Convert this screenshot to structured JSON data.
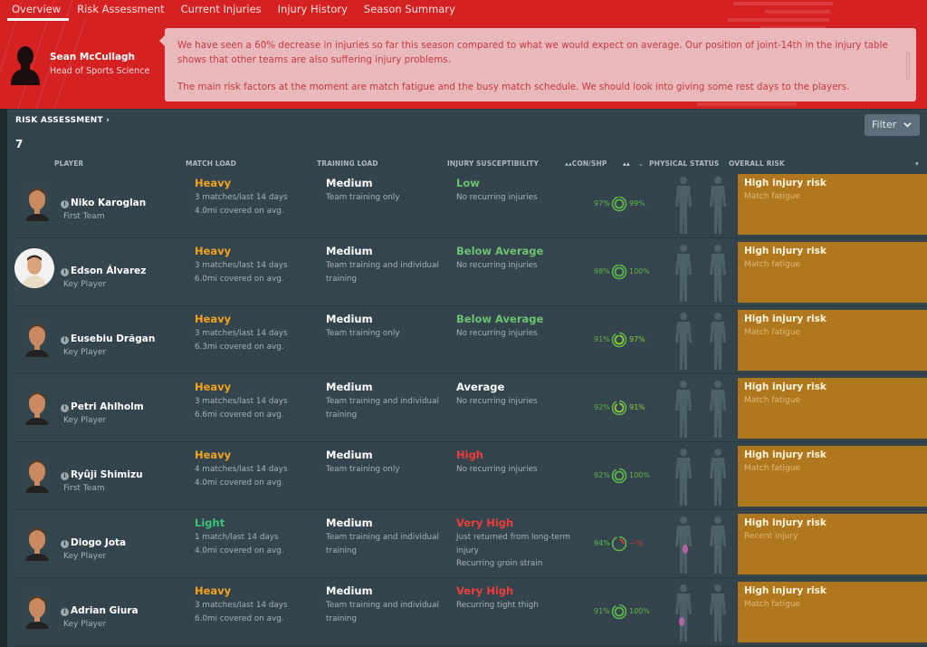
{
  "tabs": [
    {
      "label": "Overview",
      "active": true
    },
    {
      "label": "Risk Assessment",
      "active": false
    },
    {
      "label": "Current Injuries",
      "active": false
    },
    {
      "label": "Injury History",
      "active": false
    },
    {
      "label": "Season Summary",
      "active": false
    }
  ],
  "advisor": {
    "name": "Sean McCullagh",
    "role": "Head of Sports Science",
    "message_1": "We have seen a 60% decrease in injuries so far this season compared to what we would expect on average. Our position of joint-14th in the injury table shows that other teams are also suffering injury problems.",
    "message_2": "The main risk factors at the moment are match fatigue and the busy match schedule. We should look into giving some rest days to the players."
  },
  "section": {
    "title": "RISK ASSESSMENT ›",
    "count": "7",
    "filter_label": "Filter"
  },
  "columns": {
    "player": "PLAYER",
    "match_load": "MATCH LOAD",
    "training_load": "TRAINING LOAD",
    "injury_susceptibility": "INJURY SUSCEPTIBILITY",
    "con_shp": "▴▴CON/SHP",
    "physical_status_sort": "▴▴",
    "physical_status": "PHYSICAL STATUS",
    "overall_risk": "OVERALL RISK"
  },
  "colors": {
    "header_red": "#d42122",
    "panel": "#33434b",
    "heavy": "#f3a31e",
    "light": "#39c47a",
    "susc_green": "#6ec273",
    "susc_red": "#f23c3c",
    "risk_box": "#b0781e",
    "condition_green": "#5fb54b"
  },
  "players": [
    {
      "name": "Niko Karoglan",
      "status": "First Team",
      "avatar": "face",
      "match_load": "Heavy",
      "match_load_class": "orange",
      "match_detail_1": "3 matches/last 14 days",
      "match_detail_2": "4.0mi covered on avg.",
      "training_load": "Medium",
      "training_detail": "Team training only",
      "susceptibility": "Low",
      "susc_class": "green",
      "susc_detail_1": "No recurring injuries",
      "susc_detail_2": "",
      "condition": "97%",
      "sharpness": "99%",
      "condition_value": 97,
      "sharpness_value": 99,
      "sharpness_color": "#5fb54b",
      "injury_marker": "",
      "risk": "High injury risk",
      "risk_reason": "Match fatigue"
    },
    {
      "name": "Edson Álvarez",
      "status": "Key Player",
      "avatar": "round",
      "match_load": "Heavy",
      "match_load_class": "orange",
      "match_detail_1": "3 matches/last 14 days",
      "match_detail_2": "6.0mi covered on avg.",
      "training_load": "Medium",
      "training_detail": "Team training and individual training",
      "susceptibility": "Below Average",
      "susc_class": "green",
      "susc_detail_1": "No recurring injuries",
      "susc_detail_2": "",
      "condition": "98%",
      "sharpness": "100%",
      "condition_value": 98,
      "sharpness_value": 100,
      "sharpness_color": "#5fb54b",
      "injury_marker": "",
      "risk": "High injury risk",
      "risk_reason": "Match fatigue"
    },
    {
      "name": "Eusebiu Drăgan",
      "status": "Key Player",
      "avatar": "face",
      "match_load": "Heavy",
      "match_load_class": "orange",
      "match_detail_1": "3 matches/last 14 days",
      "match_detail_2": "6.3mi covered on avg.",
      "training_load": "Medium",
      "training_detail": "Team training only",
      "susceptibility": "Below Average",
      "susc_class": "green",
      "susc_detail_1": "No recurring injuries",
      "susc_detail_2": "",
      "condition": "91%",
      "sharpness": "97%",
      "condition_value": 91,
      "sharpness_value": 97,
      "sharpness_color": "#8fcc3a",
      "injury_marker": "",
      "risk": "High injury risk",
      "risk_reason": "Match fatigue"
    },
    {
      "name": "Petri Ahlholm",
      "status": "Key Player",
      "avatar": "face",
      "match_load": "Heavy",
      "match_load_class": "orange",
      "match_detail_1": "3 matches/last 14 days",
      "match_detail_2": "6.6mi covered on avg.",
      "training_load": "Medium",
      "training_detail": "Team training and individual training",
      "susceptibility": "Average",
      "susc_class": "white",
      "susc_detail_1": "No recurring injuries",
      "susc_detail_2": "",
      "condition": "92%",
      "sharpness": "91%",
      "condition_value": 92,
      "sharpness_value": 91,
      "sharpness_color": "#8fcc3a",
      "injury_marker": "",
      "risk": "High injury risk",
      "risk_reason": "Match fatigue"
    },
    {
      "name": "Ryûji Shimizu",
      "status": "First Team",
      "avatar": "face",
      "match_load": "Heavy",
      "match_load_class": "orange",
      "match_detail_1": "4 matches/last 14 days",
      "match_detail_2": "4.0mi covered on avg.",
      "training_load": "Medium",
      "training_detail": "Team training only",
      "susceptibility": "High",
      "susc_class": "red",
      "susc_detail_1": "No recurring injuries",
      "susc_detail_2": "",
      "condition": "92%",
      "sharpness": "100%",
      "condition_value": 92,
      "sharpness_value": 100,
      "sharpness_color": "#5fb54b",
      "injury_marker": "",
      "risk": "High injury risk",
      "risk_reason": "Match fatigue"
    },
    {
      "name": "Diogo Jota",
      "status": "Key Player",
      "avatar": "face",
      "match_load": "Light",
      "match_load_class": "green2",
      "match_detail_1": "1 match/last 14 days",
      "match_detail_2": "4.0mi covered on avg.",
      "training_load": "Medium",
      "training_detail": "Team training and individual training",
      "susceptibility": "Very High",
      "susc_class": "red",
      "susc_detail_1": "Just returned from long-term injury",
      "susc_detail_2": "Recurring groin strain",
      "condition": "94%",
      "sharpness": "––%",
      "condition_value": 94,
      "sharpness_value": 25,
      "sharpness_color": "#d8343a",
      "injury_marker": "groin",
      "risk": "High injury risk",
      "risk_reason": "Recent injury"
    },
    {
      "name": "Adrian Giura",
      "status": "Key Player",
      "avatar": "face",
      "match_load": "Heavy",
      "match_load_class": "orange",
      "match_detail_1": "3 matches/last 14 days",
      "match_detail_2": "6.0mi covered on avg.",
      "training_load": "Medium",
      "training_detail": "Team training and individual training",
      "susceptibility": "Very High",
      "susc_class": "red",
      "susc_detail_1": "Recurring tight thigh",
      "susc_detail_2": "",
      "condition": "91%",
      "sharpness": "100%",
      "condition_value": 91,
      "sharpness_value": 100,
      "sharpness_color": "#5fb54b",
      "injury_marker": "thigh",
      "risk": "High injury risk",
      "risk_reason": "Match fatigue"
    }
  ]
}
